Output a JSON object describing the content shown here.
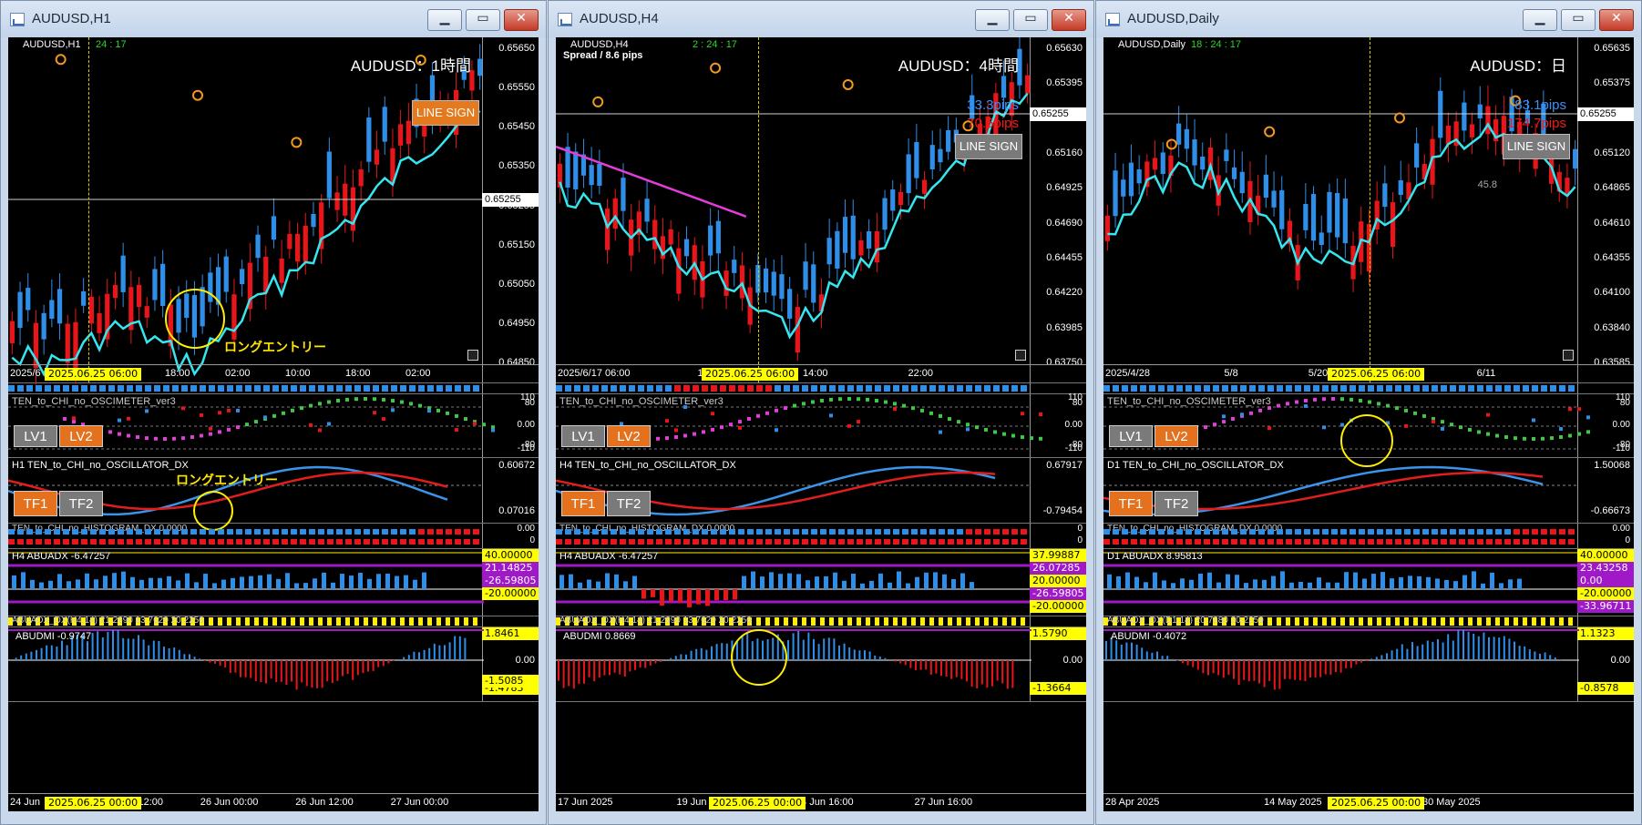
{
  "windows": [
    {
      "title": "AUDUSD,H1",
      "symbol_label": "AUDUSD,H1",
      "timer": "24 : 17",
      "spread": "",
      "heading": "AUDUSD：1時間",
      "pips_blue": "",
      "pips_red": "",
      "line_sign": "LINE SIGN",
      "price_ticks": [
        "0.65650",
        "0.65550",
        "0.65450",
        "0.65350",
        "0.65255",
        "0.65150",
        "0.65050",
        "0.64950",
        "0.64850"
      ],
      "current_price": "0.65255",
      "time_labels": [
        "2025/6",
        "00",
        "18:00",
        "02:00",
        "10:00",
        "18:00",
        "02:00"
      ],
      "date_tag": "2025.06.25 06:00",
      "entry_label": "ロングエントリー",
      "osc_label": "TEN_to_CHI_no_OSCIMETER_ver3",
      "osc_ticks": [
        "110",
        "80",
        "0.00",
        "-80",
        "-110"
      ],
      "lv1": "LV1",
      "lv2": "LV2",
      "dx_label": "H1 TEN_to_CHI_no_OSCILLATOR_DX",
      "dx_ticks": [
        "0.60672",
        "0.07016"
      ],
      "tf1": "TF1",
      "tf2": "TF2",
      "hist_label": "TEN_to_CHI_no_HISTOGRAM_DX 0.0000",
      "hist_ticks": [
        "0.00",
        "0"
      ],
      "adx_label": "H4 ABUADX -6.47257",
      "adx_tags": [
        "40.00000",
        "21.14825",
        "-26.59805",
        "-20.00000"
      ],
      "abuadx_dx": "ABUADX_DX(H4,14) 21.2690 13.7620 20.2256",
      "dmi_label": "ABUDMI -0.9747",
      "dmi_tags": [
        "1.8461",
        "0.00",
        "-1.4783",
        "-1.5085"
      ],
      "bottom_times": [
        "24 Jun",
        "25 Jun 12:00",
        "26 Jun 00:00",
        "26 Jun 12:00",
        "27 Jun 00:00"
      ],
      "bottom_date_tag": "2025.06.25 00:00"
    },
    {
      "title": "AUDUSD,H4",
      "symbol_label": "AUDUSD,H4",
      "timer": "2 : 24 : 17",
      "spread": "Spread / 8.6 pips",
      "heading": "AUDUSD：4時間",
      "pips_blue": "33.3pips",
      "pips_red": "70.5pips",
      "line_sign": "LINE SIGN",
      "price_ticks": [
        "0.65630",
        "0.65395",
        "0.65255",
        "0.65160",
        "0.64925",
        "0.64690",
        "0.64455",
        "0.64220",
        "0.63985",
        "0.63750"
      ],
      "current_price": "0.65255",
      "time_labels": [
        "2025/6/17 06:00",
        "14:00",
        "14:00",
        "22:00"
      ],
      "date_tag": "2025.06.25 06:00",
      "entry_label": "",
      "osc_label": "TEN_to_CHI_no_OSCIMETER_ver3",
      "osc_ticks": [
        "110",
        "80",
        "0.00",
        "-80",
        "-110"
      ],
      "lv1": "LV1",
      "lv2": "LV2",
      "dx_label": "H4 TEN_to_CHI_no_OSCILLATOR_DX",
      "dx_ticks": [
        "0.67917",
        "-0.79454"
      ],
      "tf1": "TF1",
      "tf2": "TF2",
      "hist_label": "TEN_to_CHI_no_HISTOGRAM_DX 0.0000",
      "hist_ticks": [
        "0",
        "0"
      ],
      "adx_label": "H4 ABUADX -6.47257",
      "adx_tags": [
        "37.99887",
        "26.07285",
        "20.00000",
        "-26.59805",
        "-20.00000"
      ],
      "abuadx_dx": "ABUADX_DX(H4,14) 21.2690 13.7620 20.2256",
      "dmi_label": "ABUDMI 0.8669",
      "dmi_tags": [
        "1.5790",
        "0.00",
        "-1.3664"
      ],
      "bottom_times": [
        "17 Jun 2025",
        "19 Jun 16:00",
        "24 Jun 16:00",
        "27 Jun 16:00"
      ],
      "bottom_date_tag": "2025.06.25 00:00"
    },
    {
      "title": "AUDUSD,Daily",
      "symbol_label": "AUDUSD,Daily",
      "timer": "18 : 24 : 17",
      "spread": "",
      "heading": "AUDUSD：日",
      "pips_blue": "83.1pips",
      "pips_red": "174.7pips",
      "line_sign": "LINE SIGN",
      "side_value": "45.8",
      "price_ticks": [
        "0.65635",
        "0.65375",
        "0.65255",
        "0.65120",
        "0.64865",
        "0.64610",
        "0.64355",
        "0.64100",
        "0.63840",
        "0.63585"
      ],
      "current_price": "0.65255",
      "time_labels": [
        "2025/4/28",
        "5/8",
        "5/20",
        "5/30",
        "6/11"
      ],
      "date_tag": "2025.06.25 06:00",
      "entry_label": "",
      "osc_label": "TEN_to_CHI_no_OSCIMETER_ver3",
      "osc_ticks": [
        "110",
        "80",
        "0.00",
        "-80",
        "-110"
      ],
      "lv1": "LV1",
      "lv2": "LV2",
      "dx_label": "D1 TEN_to_CHI_no_OSCILLATOR_DX",
      "dx_ticks": [
        "1.50068",
        "-0.66673"
      ],
      "tf1": "TF1",
      "tf2": "TF2",
      "hist_label": "TEN_to_CHI_no_HISTOGRAM_DX 0.0000",
      "hist_ticks": [
        "0.00",
        "0"
      ],
      "adx_label": "D1 ABUADX 8.95813",
      "adx_tags": [
        "40.00000",
        "23.43258",
        "0.00",
        "-20.00000",
        "-33.96711"
      ],
      "abuadx_dx": "ABUADX_DX(D1,14) 20.7280 20.2259",
      "dmi_label": "ABUDMI -0.4072",
      "dmi_tags": [
        "1.1323",
        "0.00",
        "-0.8578"
      ],
      "bottom_times": [
        "28 Apr 2025",
        "14 May 2025",
        "30 May 2025"
      ],
      "bottom_date_tag": "2025.06.25 00:00"
    }
  ],
  "colors": {
    "bull": "#2f8ee8",
    "bear": "#e8161a",
    "ma_cyan": "#35e6f0",
    "ma_magenta": "#e23ddb",
    "ma_grey": "#9b9b9b",
    "marker_orange": "#f39a1c",
    "annotation_yellow": "#ffee00"
  },
  "title_buttons": [
    "minimize-icon",
    "maximize-icon",
    "close-icon"
  ]
}
